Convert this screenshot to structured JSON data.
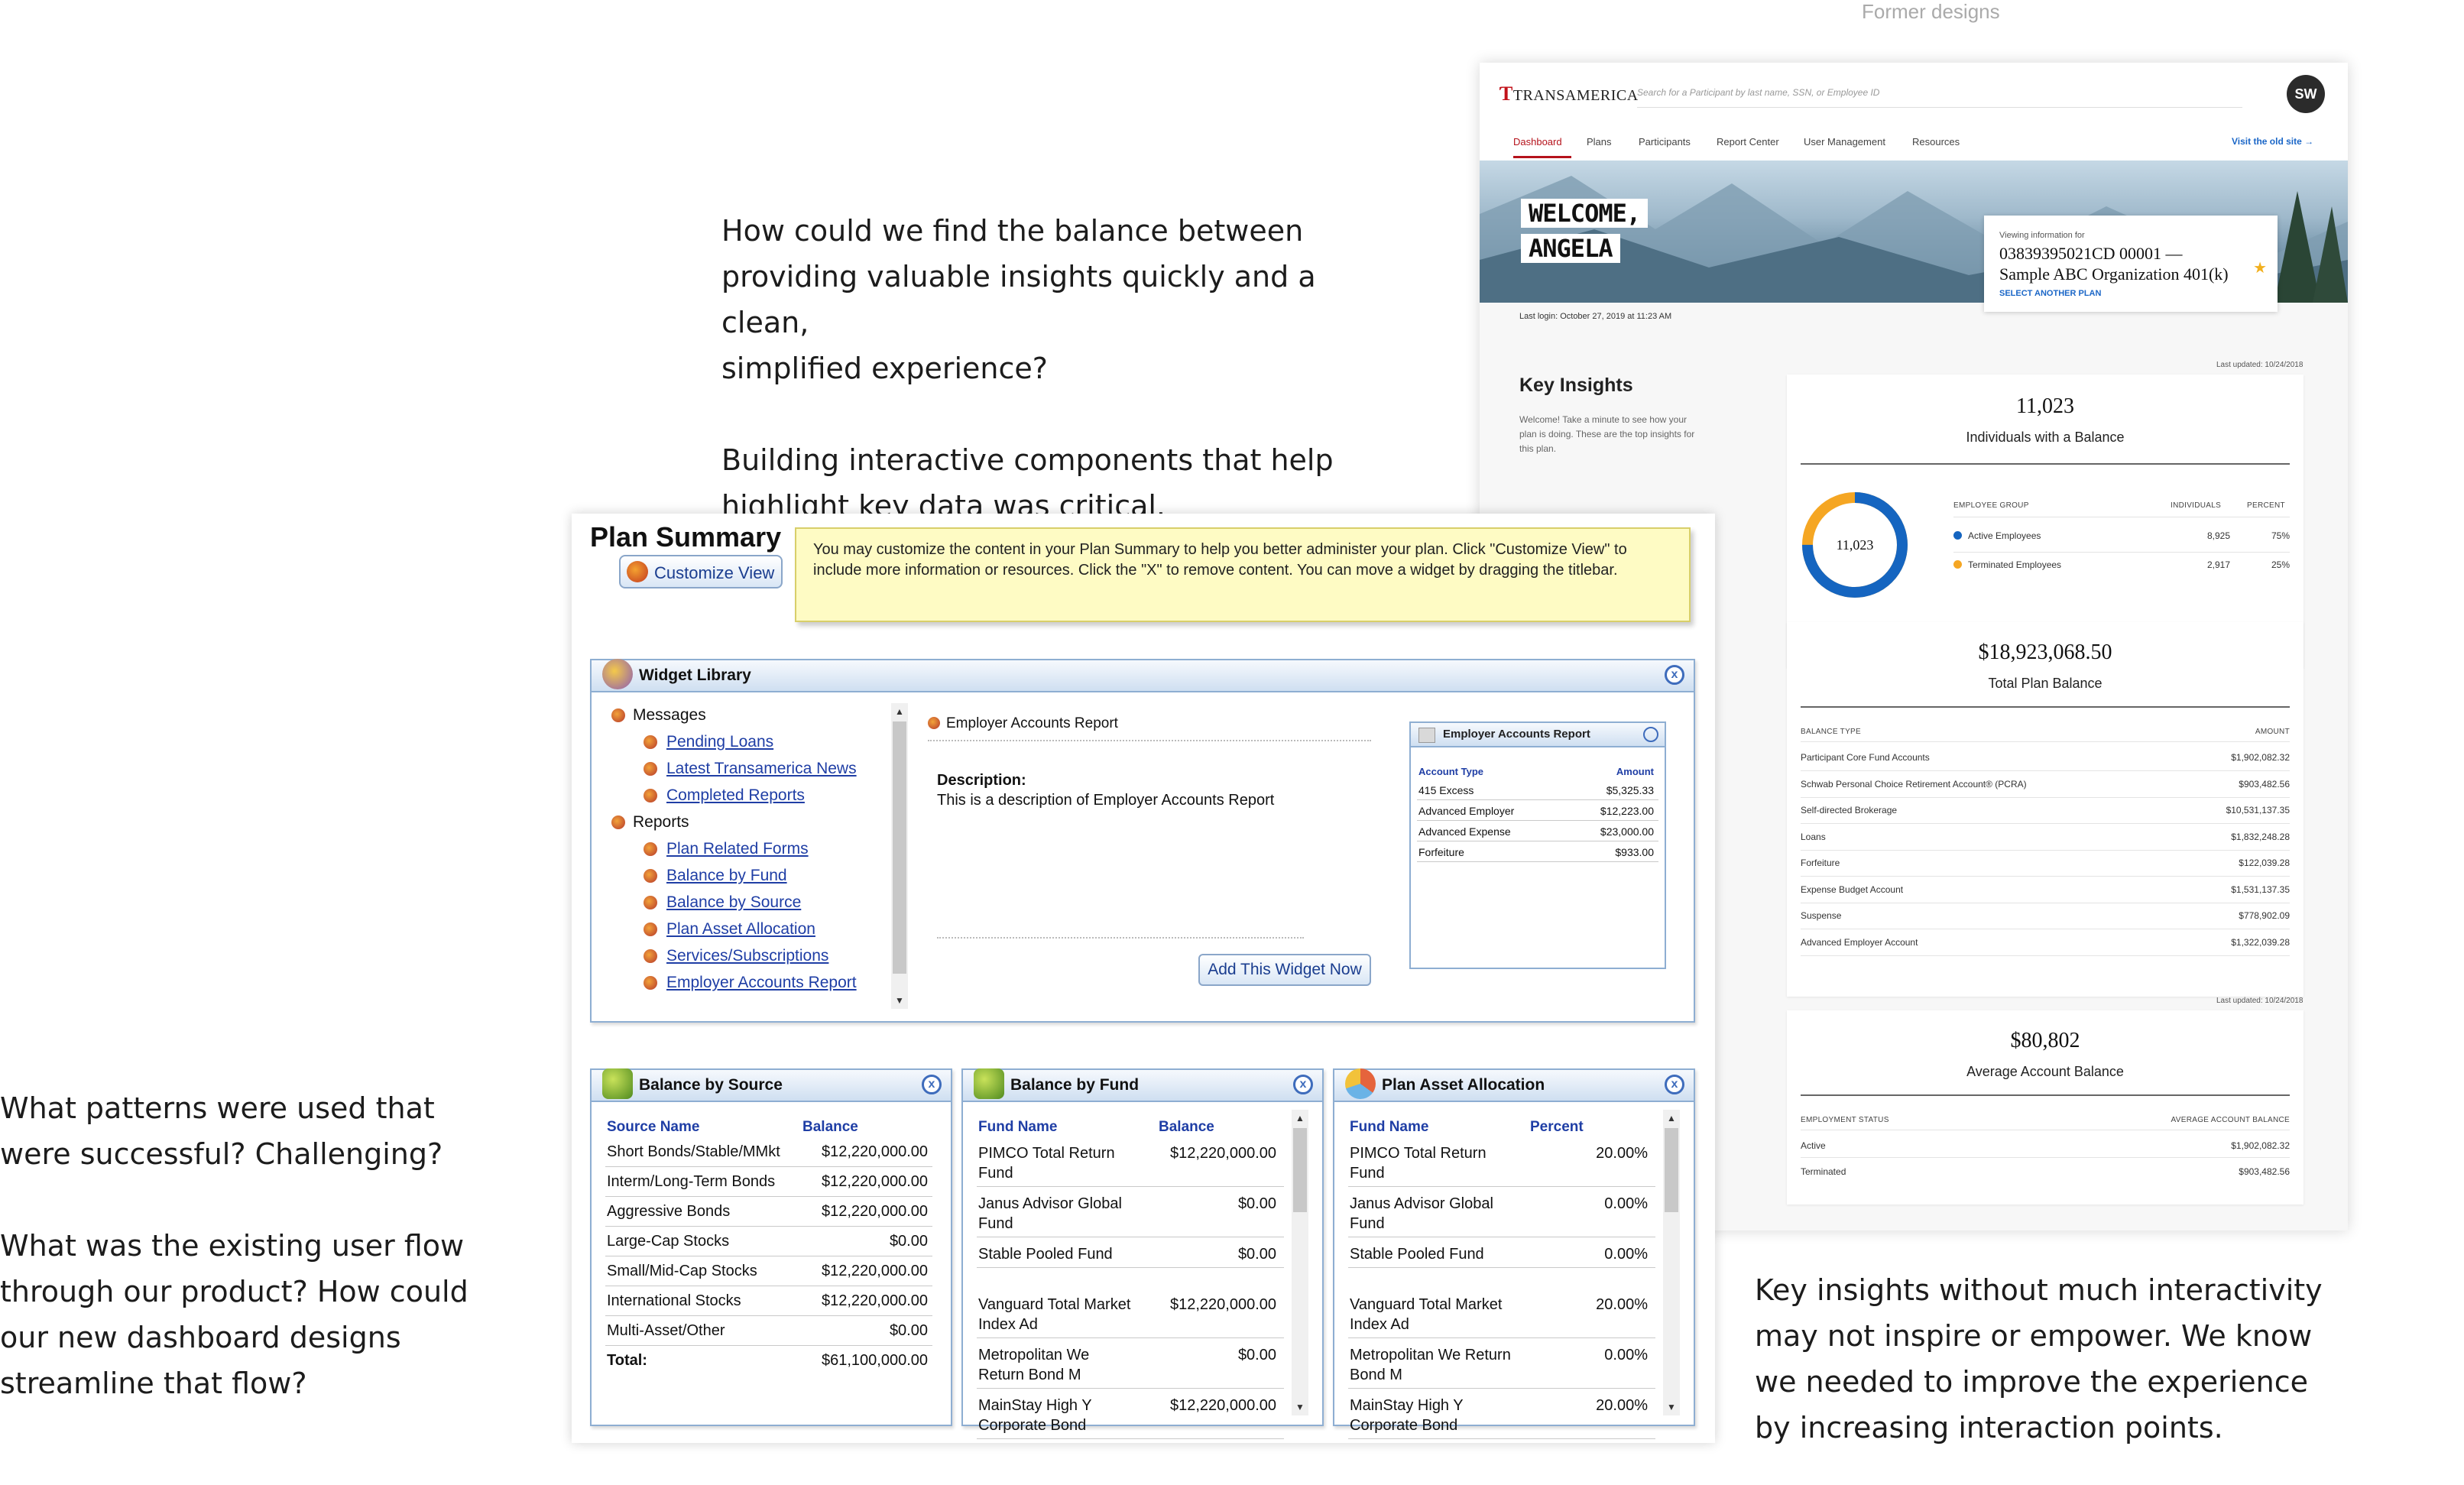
{
  "header": {
    "former_label": "Former designs"
  },
  "captions": {
    "top": "How could we find the balance between\nproviding valuable insights quickly and a clean,\nsimplified experience?\n\nBuilding interactive components that help\nhighlight key data was critical.",
    "left": "What patterns were used that\nwere successful? Challenging?\n\nWhat was the existing user flow\nthrough our product? How could\nour new dashboard designs\nstreamline that flow?",
    "right": "Key insights without much interactivity\nmay not inspire or empower. We know\nwe needed to improve the experience\nby increasing interaction points."
  },
  "legacy": {
    "title": "Plan Summary",
    "customize_label": "Customize View",
    "note": "You may customize the content in your Plan Summary to help you better administer your plan. Click \"Customize View\" to include more information or resources. Click the \"X\" to remove content. You can move a widget by dragging the titlebar.",
    "widget_library": {
      "title": "Widget Library",
      "close": "x",
      "messages_label": "Messages",
      "message_items": [
        "Pending Loans",
        "Latest Transamerica News",
        "Completed Reports"
      ],
      "reports_label": "Reports",
      "report_items": [
        "Plan Related Forms",
        "Balance by Fund",
        "Balance by Source",
        "Plan Asset Allocation",
        "Services/Subscriptions",
        "Employer Accounts Report"
      ],
      "selected_title": "Employer Accounts Report",
      "description_label": "Description:",
      "description_text": "This is a description of Employer Accounts Report",
      "add_button": "Add This Widget Now",
      "preview": {
        "title": "Employer Accounts Report",
        "col1": "Account Type",
        "col2": "Amount",
        "rows": [
          {
            "type": "415 Excess",
            "amount": "$5,325.33"
          },
          {
            "type": "Advanced Employer",
            "amount": "$12,223.00"
          },
          {
            "type": "Advanced Expense",
            "amount": "$23,000.00"
          },
          {
            "type": "Forfeiture",
            "amount": "$933.00"
          }
        ]
      }
    },
    "balance_by_source": {
      "title": "Balance by Source",
      "col1": "Source Name",
      "col2": "Balance",
      "rows": [
        {
          "name": "Short Bonds/Stable/MMkt",
          "value": "$12,220,000.00"
        },
        {
          "name": "Interm/Long-Term Bonds",
          "value": "$12,220,000.00"
        },
        {
          "name": "Aggressive Bonds",
          "value": "$12,220,000.00"
        },
        {
          "name": "Large-Cap Stocks",
          "value": "$0.00"
        },
        {
          "name": "Small/Mid-Cap Stocks",
          "value": "$12,220,000.00"
        },
        {
          "name": "International Stocks",
          "value": "$12,220,000.00"
        },
        {
          "name": "Multi-Asset/Other",
          "value": "$0.00"
        }
      ],
      "total_label": "Total:",
      "total_value": "$61,100,000.00"
    },
    "balance_by_fund": {
      "title": "Balance by Fund",
      "col1": "Fund Name",
      "col2": "Balance",
      "rows": [
        {
          "l1": "PIMCO Total Return",
          "l2": "Fund",
          "value": "$12,220,000.00"
        },
        {
          "l1": "Janus Advisor Global",
          "l2": "Fund",
          "value": "$0.00"
        },
        {
          "l1": "Stable Pooled Fund",
          "l2": "",
          "value": "$0.00"
        },
        {
          "l1": "Vanguard Total Market",
          "l2": "Index Ad",
          "value": "$12,220,000.00"
        },
        {
          "l1": "Metropolitan We",
          "l2": "Return Bond M",
          "value": "$0.00"
        },
        {
          "l1": "MainStay High Y",
          "l2": "Corporate Bond",
          "value": "$12,220,000.00"
        }
      ]
    },
    "plan_asset_allocation": {
      "title": "Plan Asset Allocation",
      "col1": "Fund Name",
      "col2": "Percent",
      "rows": [
        {
          "l1": "PIMCO Total Return",
          "l2": "Fund",
          "value": "20.00%"
        },
        {
          "l1": "Janus Advisor Global",
          "l2": "Fund",
          "value": "0.00%"
        },
        {
          "l1": "Stable Pooled Fund",
          "l2": "",
          "value": "0.00%"
        },
        {
          "l1": "Vanguard Total Market",
          "l2": "Index Ad",
          "value": "20.00%"
        },
        {
          "l1": "Metropolitan We Return",
          "l2": "Bond M",
          "value": "0.00%"
        },
        {
          "l1": "MainStay High Y",
          "l2": "Corporate Bond",
          "value": "20.00%"
        }
      ]
    }
  },
  "modern": {
    "logo": "TRANSAMERICA",
    "search_placeholder": "Search for a Participant by last name, SSN, or Employee ID",
    "avatar": "SW",
    "nav": [
      "Dashboard",
      "Plans",
      "Participants",
      "Report Center",
      "User Management",
      "Resources"
    ],
    "old_site": "Visit the old site →",
    "welcome_line1": "WELCOME,",
    "welcome_line2": "ANGELA",
    "viewing_label": "Viewing information for",
    "plan_id": "03839395021CD 00001 —",
    "plan_name": "Sample ABC Organization 401(k)",
    "select_plan": "SELECT ANOTHER PLAN",
    "last_login": "Last login: October 27, 2019 at 11:23 AM",
    "key_insights_title": "Key Insights",
    "key_insights_desc": "Welcome! Take a minute to see how your plan is doing. These are the top insights for this plan.",
    "individuals": {
      "updated": "Last updated: 10/24/2018",
      "value": "11,023",
      "label": "Individuals with a Balance",
      "donut_value": "11,023",
      "col1": "EMPLOYEE GROUP",
      "col2": "INDIVIDUALS",
      "col3": "PERCENT",
      "rows": [
        {
          "name": "Active Employees",
          "count": "8,925",
          "pct": "75%",
          "color": "#1565c0",
          "share": 0.75
        },
        {
          "name": "Terminated Employees",
          "count": "2,917",
          "pct": "25%",
          "color": "#f5a623",
          "share": 0.25
        }
      ]
    },
    "total_balance": {
      "value": "$18,923,068.50",
      "label": "Total Plan Balance",
      "col1": "BALANCE TYPE",
      "col2": "AMOUNT",
      "rows": [
        {
          "name": "Participant Core Fund Accounts",
          "amount": "$1,902,082.32"
        },
        {
          "name": "Schwab Personal Choice Retirement Account® (PCRA)",
          "amount": "$903,482.56"
        },
        {
          "name": "Self-directed Brokerage",
          "amount": "$10,531,137.35"
        },
        {
          "name": "Loans",
          "amount": "$1,832,248.28"
        },
        {
          "name": "Forfeiture",
          "amount": "$122,039.28"
        },
        {
          "name": "Expense Budget Account",
          "amount": "$1,531,137.35"
        },
        {
          "name": "Suspense",
          "amount": "$778,902.09"
        },
        {
          "name": "Advanced Employer Account",
          "amount": "$1,322,039.28"
        }
      ]
    },
    "average": {
      "updated": "Last updated: 10/24/2018",
      "value": "$80,802",
      "label": "Average Account Balance",
      "col1": "EMPLOYMENT STATUS",
      "col2": "AVERAGE ACCOUNT BALANCE",
      "rows": [
        {
          "name": "Active",
          "amount": "$1,902,082.32"
        },
        {
          "name": "Terminated",
          "amount": "$903,482.56"
        }
      ]
    }
  }
}
